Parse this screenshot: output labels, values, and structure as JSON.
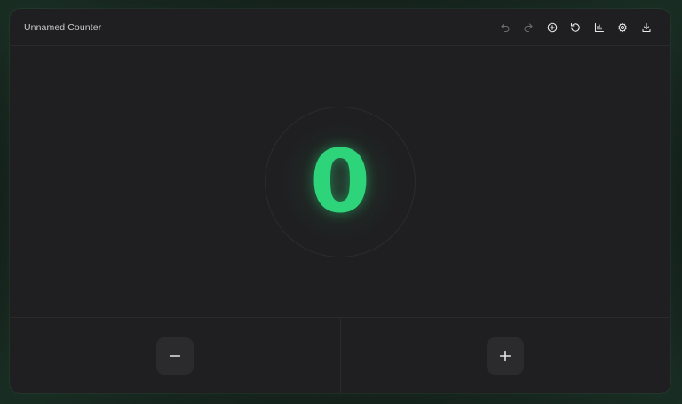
{
  "header": {
    "title": "Unnamed Counter",
    "toolbar": [
      {
        "icon": "undo-icon",
        "enabled": false
      },
      {
        "icon": "redo-icon",
        "enabled": false
      },
      {
        "icon": "add-circle-icon",
        "enabled": true
      },
      {
        "icon": "reset-icon",
        "enabled": true
      },
      {
        "icon": "stats-chart-icon",
        "enabled": true
      },
      {
        "icon": "settings-gear-icon",
        "enabled": true
      },
      {
        "icon": "download-icon",
        "enabled": true
      }
    ]
  },
  "counter": {
    "value": "0",
    "color": "#2ed47a"
  },
  "controls": {
    "decrement_icon": "minus-icon",
    "increment_icon": "plus-icon"
  }
}
